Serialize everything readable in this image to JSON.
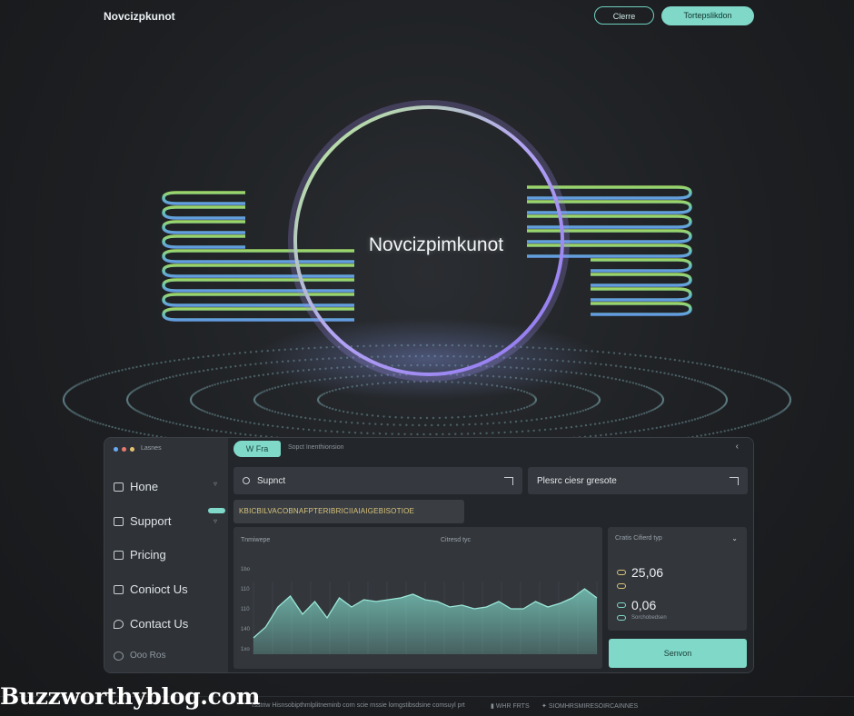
{
  "header": {
    "brand": "Novcizpkunot",
    "outline_button": "Clerre",
    "solid_button": "Tortepslikdon"
  },
  "hero": {
    "title": "Novcizpimkunot"
  },
  "window": {
    "title": "Lasnes",
    "tab_active": "W Fra",
    "tab_text": "Sopct Inenthionsion",
    "close_glyph": "‹",
    "nav": [
      {
        "label": "Hone",
        "icon": "home-icon"
      },
      {
        "label": "Support",
        "icon": "support-icon"
      },
      {
        "label": "Pricing",
        "icon": "pricing-icon"
      },
      {
        "label": "Conioct Us",
        "icon": "contact-icon"
      },
      {
        "label": "Contact Us",
        "icon": "chat-icon"
      }
    ],
    "nav_footer": "Ooo Ros",
    "search": {
      "value": "Supnct"
    },
    "field2": {
      "value": "Plesrc ciesr gresote"
    },
    "banner": "KBICBILVACOBNAFPTERIBRICIIAIAIGEBISOTIOE",
    "chart": {
      "left_label": "Tnmiwepe",
      "center_label": "Citresd tyc"
    },
    "stats": {
      "header": "Cratis Cifierd typ",
      "value1": "25,06",
      "value2": "0,06",
      "sub2": "Sorchobedsen"
    },
    "cta": "Senvon"
  },
  "chart_data": {
    "type": "area",
    "title": "",
    "ylabel": "",
    "y_ticks": [
      "1bo",
      "110",
      "110",
      "140",
      "1xo"
    ],
    "x": [
      0,
      1,
      2,
      3,
      4,
      5,
      6,
      7,
      8,
      9,
      10,
      11,
      12,
      13,
      14,
      15,
      16,
      17,
      18,
      19,
      20,
      21,
      22,
      23,
      24,
      25,
      26,
      27,
      28
    ],
    "values": [
      18,
      30,
      52,
      64,
      44,
      58,
      40,
      62,
      52,
      60,
      58,
      60,
      62,
      66,
      60,
      58,
      52,
      54,
      50,
      52,
      58,
      50,
      50,
      58,
      52,
      56,
      62,
      72,
      62
    ],
    "ylim": [
      0,
      100
    ],
    "color": "#7fd8c8",
    "grid": true
  },
  "watermark": "Buzzworthyblog.com",
  "footer": {
    "left": "Tsstriw Hisnsobipthmlplitneminb corn scie rnssie lomgstibsdsine comsuyl prt",
    "mid": "WHR FRTS",
    "right": "SIOMHRSMIRESOIRCAINNES"
  },
  "colors": {
    "accent": "#7fd8c8",
    "ring": "#a98cf0",
    "green": "#9ae07a",
    "blue": "#63b4ff"
  }
}
